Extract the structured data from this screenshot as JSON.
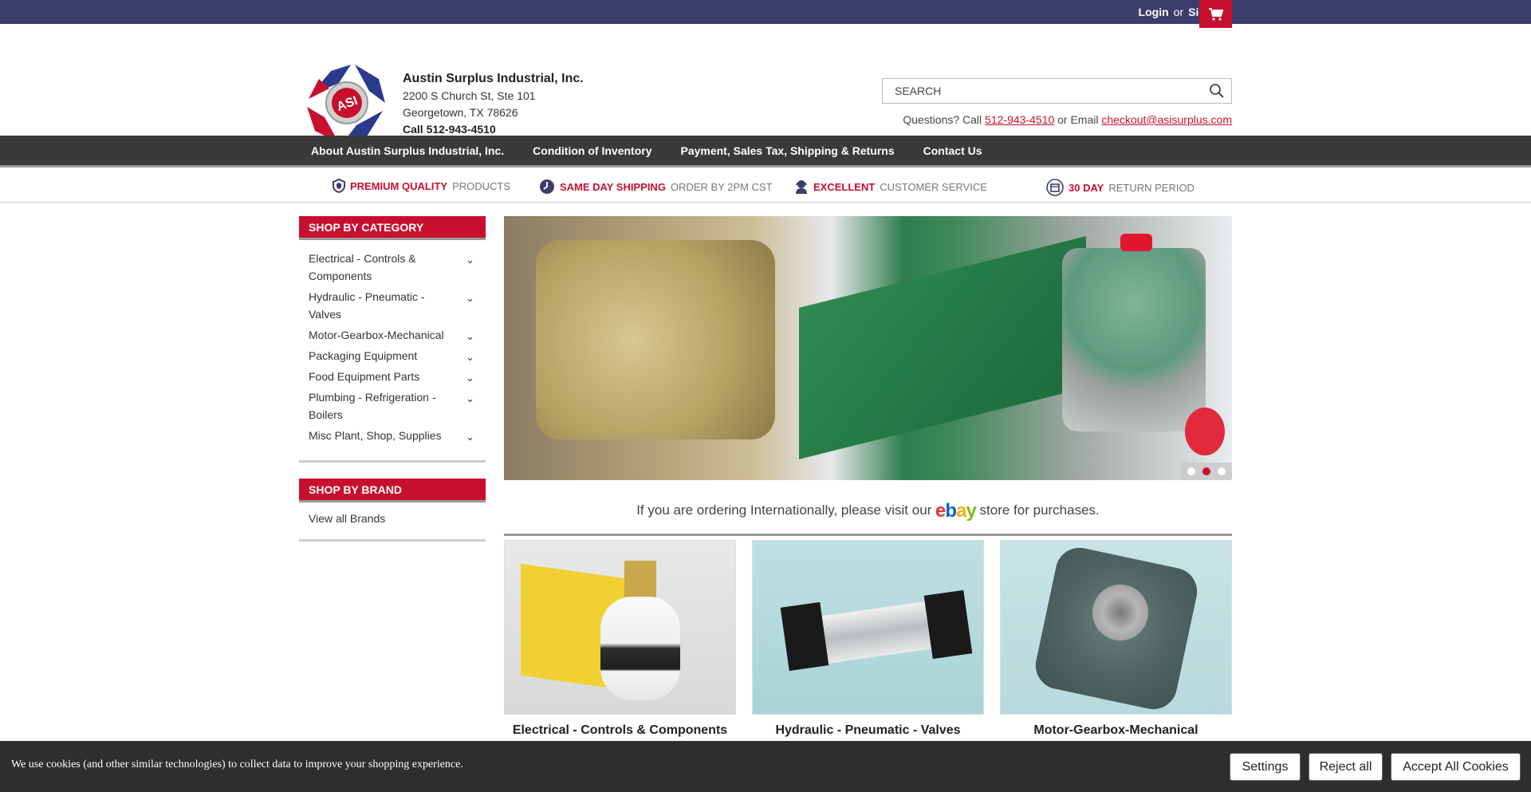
{
  "topbar": {
    "login": "Login",
    "or": "or",
    "signup": "Sign Up",
    "cart_icon": "cart-icon"
  },
  "company": {
    "name": "Austin Surplus Industrial, Inc.",
    "address1": "2200 S Church St, Ste 101",
    "address2": "Georgetown, TX 78626",
    "call": "Call 512-943-4510"
  },
  "search": {
    "placeholder": "SEARCH",
    "icon": "search-icon"
  },
  "questions": {
    "prefix": "Questions? Call",
    "phone": "512-943-4510",
    "middle": "or Email",
    "email": "checkout@asisurplus.com"
  },
  "nav": {
    "items": [
      "About Austin Surplus Industrial, Inc.",
      "Condition of Inventory",
      "Payment, Sales Tax, Shipping & Returns",
      "Contact Us"
    ]
  },
  "perks": [
    {
      "bold": "PREMIUM QUALITY",
      "rest": "PRODUCTS",
      "icon": "shield-icon"
    },
    {
      "bold": "SAME DAY SHIPPING",
      "rest": "ORDER BY 2PM CST",
      "icon": "clock-icon"
    },
    {
      "bold": "EXCELLENT",
      "rest": "CUSTOMER SERVICE",
      "icon": "headset-icon"
    },
    {
      "bold": "30 DAY",
      "rest": "RETURN PERIOD",
      "icon": "calendar-icon"
    }
  ],
  "sidebar": {
    "category_heading": "SHOP BY CATEGORY",
    "categories": [
      "Electrical - Controls & Components",
      "Hydraulic - Pneumatic - Valves",
      "Motor-Gearbox-Mechanical",
      "Packaging Equipment",
      "Food Equipment Parts",
      "Plumbing - Refrigeration - Boilers",
      "Misc Plant, Shop, Supplies"
    ],
    "brand_heading": "SHOP BY BRAND",
    "brand_link": "View all Brands"
  },
  "carousel": {
    "slides": 3,
    "active": 2
  },
  "intl": {
    "before": "If you are ordering Internationally, please visit our",
    "after": "store for purchases.",
    "ebay": [
      "e",
      "b",
      "a",
      "y"
    ]
  },
  "tiles": [
    "Electrical - Controls & Components",
    "Hydraulic - Pneumatic - Valves",
    "Motor-Gearbox-Mechanical"
  ],
  "cookie": {
    "message": "We use cookies (and other similar technologies) to collect data to improve your shopping experience.",
    "settings": "Settings",
    "reject": "Reject all",
    "accept": "Accept All Cookies"
  },
  "colors": {
    "brand_red": "#c8102e",
    "topbar": "#3c3d6b",
    "nav": "#3a3a3a"
  }
}
